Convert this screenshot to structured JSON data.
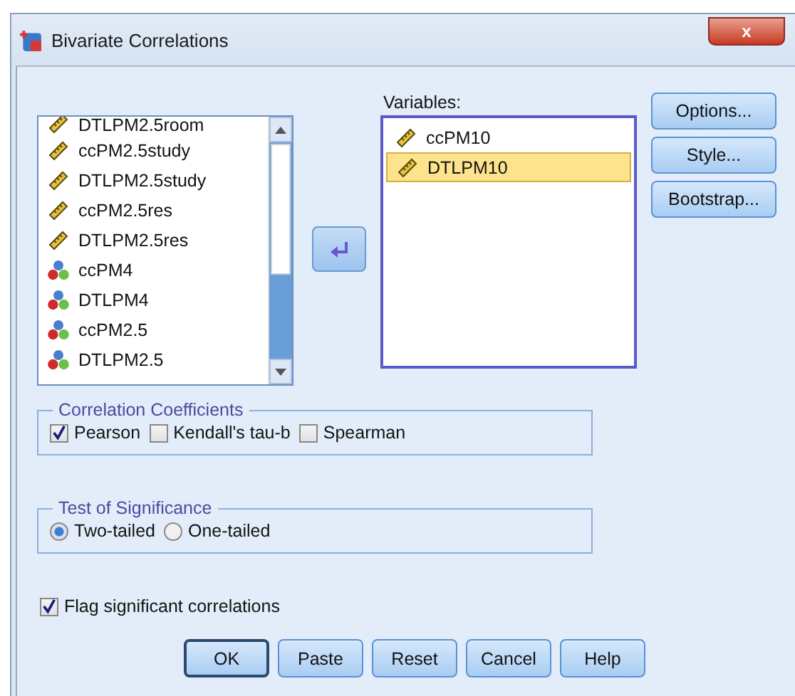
{
  "window": {
    "title": "Bivariate Correlations",
    "close": "x"
  },
  "source_list": {
    "items": [
      {
        "name": "DTLPM2.5room",
        "kind": "scale",
        "selected": false
      },
      {
        "name": "ccPM2.5study",
        "kind": "scale",
        "selected": false
      },
      {
        "name": "DTLPM2.5study",
        "kind": "scale",
        "selected": false
      },
      {
        "name": "ccPM2.5res",
        "kind": "scale",
        "selected": false
      },
      {
        "name": "DTLPM2.5res",
        "kind": "scale",
        "selected": false
      },
      {
        "name": "ccPM4",
        "kind": "nominal",
        "selected": false
      },
      {
        "name": "DTLPM4",
        "kind": "nominal",
        "selected": false
      },
      {
        "name": "ccPM2.5",
        "kind": "nominal",
        "selected": false
      },
      {
        "name": "DTLPM2.5",
        "kind": "nominal",
        "selected": false
      }
    ]
  },
  "variables": {
    "label": "Variables:",
    "items": [
      {
        "name": "ccPM10",
        "kind": "scale",
        "selected": false
      },
      {
        "name": "DTLPM10",
        "kind": "scale",
        "selected": true
      }
    ]
  },
  "side_buttons": [
    "Options...",
    "Style...",
    "Bootstrap..."
  ],
  "correlation_coefficients": {
    "title": "Correlation Coefficients",
    "options": [
      {
        "label": "Pearson",
        "checked": true
      },
      {
        "label": "Kendall's tau-b",
        "checked": false
      },
      {
        "label": "Spearman",
        "checked": false
      }
    ]
  },
  "test_of_significance": {
    "title": "Test of Significance",
    "options": [
      {
        "label": "Two-tailed",
        "selected": true
      },
      {
        "label": "One-tailed",
        "selected": false
      }
    ]
  },
  "flag": {
    "label": "Flag significant correlations",
    "checked": true
  },
  "buttons": [
    {
      "label": "OK",
      "default": true
    },
    {
      "label": "Paste",
      "default": false
    },
    {
      "label": "Reset",
      "default": false
    },
    {
      "label": "Cancel",
      "default": false
    },
    {
      "label": "Help",
      "default": false
    }
  ]
}
